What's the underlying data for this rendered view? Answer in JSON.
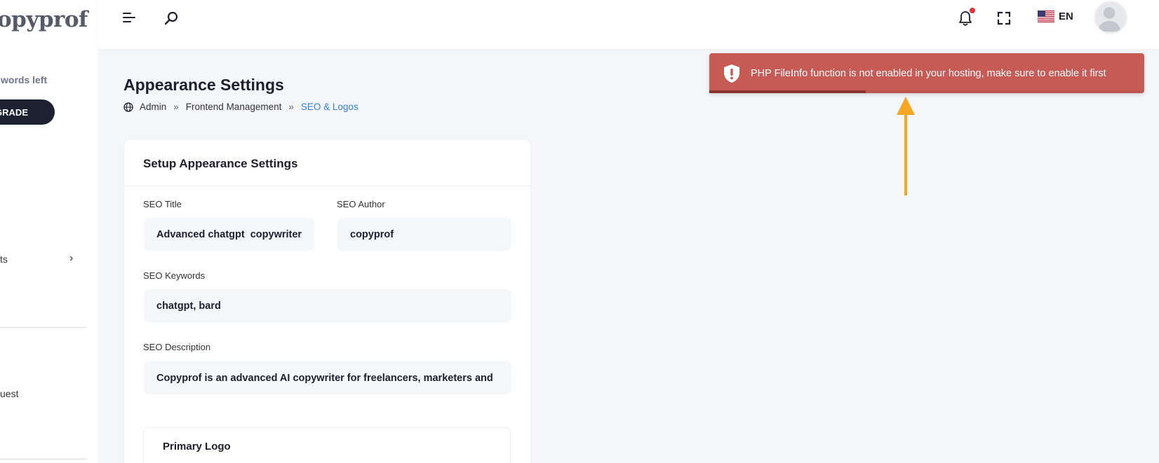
{
  "sidebar": {
    "logo_text": "opyprof",
    "words_left": "words left",
    "upgrade_label": "GRADE",
    "item_1": "ts",
    "item_2": "uest"
  },
  "topbar": {
    "language": "EN"
  },
  "page": {
    "title": "Appearance Settings",
    "breadcrumb": [
      "Admin",
      "Frontend Management",
      "SEO & Logos"
    ],
    "breadcrumb_sep": "»"
  },
  "card": {
    "title": "Setup Appearance Settings",
    "seo_title_label": "SEO Title",
    "seo_title_value": "Advanced chatgpt  copywriter",
    "seo_author_label": "SEO Author",
    "seo_author_value": "copyprof",
    "seo_keywords_label": "SEO Keywords",
    "seo_keywords_value": "chatgpt, bard",
    "seo_description_label": "SEO Description",
    "seo_description_value": "Copyprof is an advanced AI copywriter for freelancers, marketers and",
    "primary_logo_title": "Primary Logo"
  },
  "toast": {
    "message": "PHP FileInfo function is not enabled in your hosting, make sure to enable it first",
    "progress_fraction": 0.36,
    "color": "#c85a56"
  },
  "colors": {
    "accent": "#2f7ee8",
    "annotation_arrow": "#f5a623",
    "dark_button": "#1d2233"
  }
}
